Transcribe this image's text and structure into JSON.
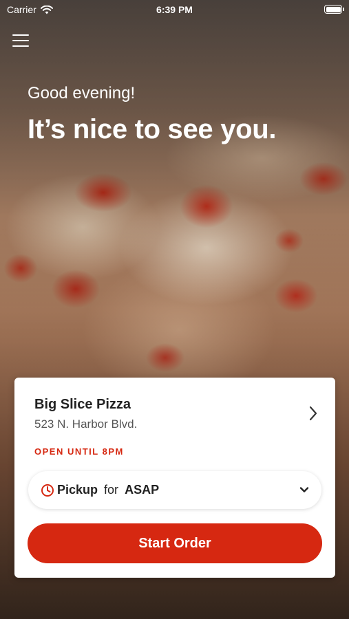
{
  "status_bar": {
    "carrier": "Carrier",
    "time": "6:39 PM",
    "battery_level": 1.0
  },
  "icons": {
    "menu": "menu-icon",
    "wifi": "wifi-icon",
    "battery": "battery-icon",
    "chevron_right": "chevron-right-icon",
    "clock": "clock-icon",
    "chevron_down": "chevron-down-icon"
  },
  "hero": {
    "greeting": "Good evening!",
    "headline": "It’s nice to see you."
  },
  "store": {
    "name": "Big Slice Pizza",
    "address": "523 N. Harbor Blvd.",
    "hours": "OPEN UNTIL 8PM"
  },
  "order_type": {
    "mode": "Pickup",
    "connector": "for",
    "time": "ASAP"
  },
  "actions": {
    "start_order": "Start Order"
  },
  "colors": {
    "accent": "#d62811",
    "card_background": "#ffffff",
    "text_primary": "#222222",
    "text_secondary": "#555555"
  }
}
